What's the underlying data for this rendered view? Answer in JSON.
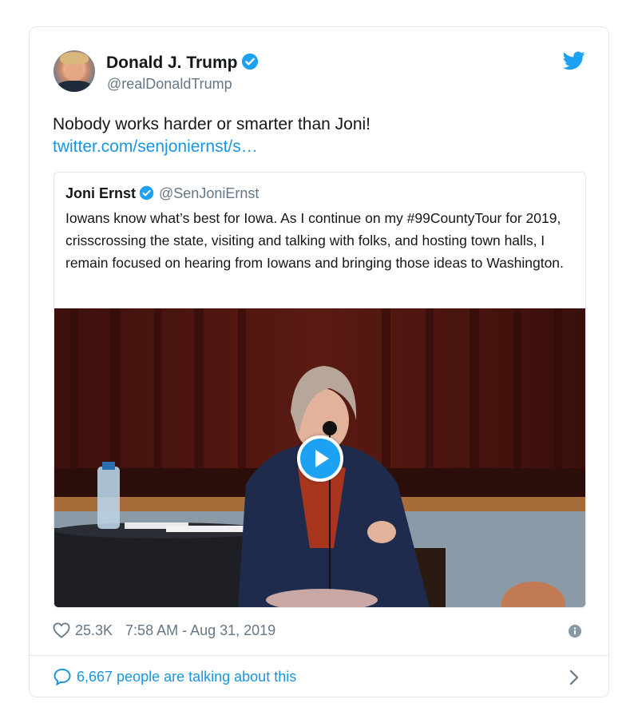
{
  "author": {
    "name": "Donald J. Trump",
    "handle": "@realDonaldTrump"
  },
  "tweet": {
    "text": "Nobody works harder or smarter than Joni!",
    "link": "twitter.com/senjoniernst/s…"
  },
  "quoted": {
    "name": "Joni Ernst",
    "handle": "@SenJoniErnst",
    "text": "Iowans know what’s best for Iowa. As I continue on my #99CountyTour for 2019, crisscrossing the state, visiting and talking with folks, and hosting town halls, I remain focused on hearing from Iowans and bringing those ideas to Washington."
  },
  "stats": {
    "likes": "25.3K",
    "timestamp": "7:58 AM - Aug 31, 2019"
  },
  "footer": {
    "talking": "6,667 people are talking about this"
  },
  "icons": {
    "verified": "verified-badge-icon",
    "bird": "twitter-bird-icon",
    "heart": "heart-outline-icon",
    "info": "info-icon",
    "comment": "speech-bubble-icon",
    "chevron": "chevron-right-icon",
    "play": "play-icon"
  },
  "colors": {
    "accent": "#1da1f2",
    "link": "#1b95e0",
    "text": "#14171a",
    "secondary": "#657786",
    "border": "#e1e8ed"
  }
}
